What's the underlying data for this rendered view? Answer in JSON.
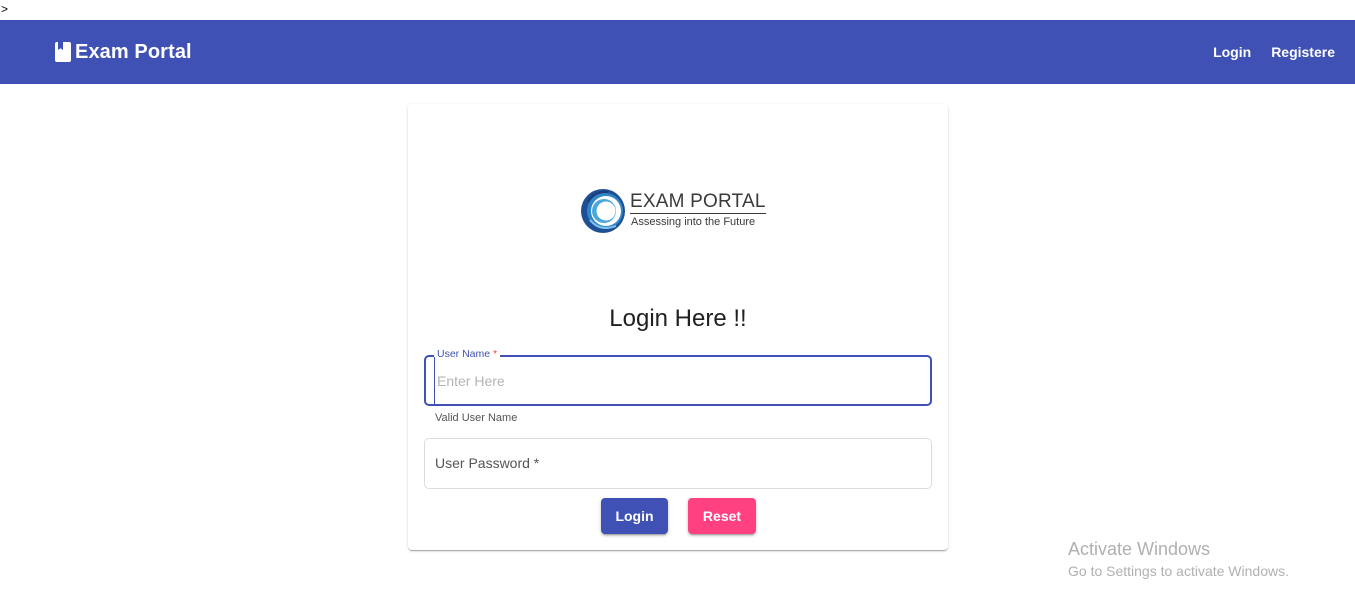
{
  "stray_text": ">",
  "navbar": {
    "icon": "book-icon",
    "title": "Exam Portal",
    "links": [
      "Login",
      "Registere"
    ],
    "color": "#3f51b5"
  },
  "logo": {
    "title": "EXAM PORTAL",
    "tagline": "Assessing into the Future"
  },
  "form": {
    "heading": "Login Here !!",
    "username": {
      "label": "User Name",
      "required_mark": "*",
      "placeholder": "Enter Here",
      "hint": "Valid User Name"
    },
    "password": {
      "label": "User Password *"
    },
    "buttons": {
      "login": "Login",
      "reset": "Reset"
    }
  },
  "watermark": {
    "line1": "Activate Windows",
    "line2": "Go to Settings to activate Windows."
  },
  "colors": {
    "primary": "#3f51b5",
    "accent": "#ff4081",
    "warn": "#f44336"
  }
}
